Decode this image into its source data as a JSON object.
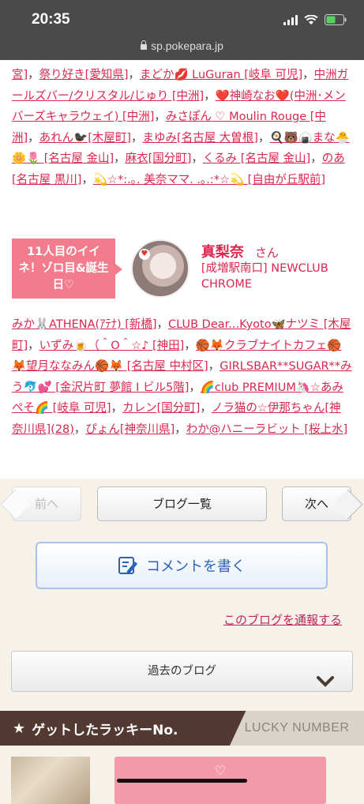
{
  "status_bar": {
    "time": "20:35",
    "url": "sp.pokepara.jp"
  },
  "likes_top": [
    {
      "text": "宮]"
    },
    {
      "text": "祭り好き[愛知県]"
    },
    {
      "text": "まどか💋 LuGuran [岐阜 可児]"
    },
    {
      "text": "中洲ガールズバー/クリスタル/じゅり [中洲]"
    },
    {
      "text": "❤️神崎なお❤️(中洲･メンバーズキャラウェイ) [中洲]"
    },
    {
      "text": "みさぽん ♡ Moulin Rouge [中洲]"
    },
    {
      "text": "あれん🐦‍⬛[木屋町]"
    },
    {
      "text": "まゆみ[名古屋 大曽根]"
    },
    {
      "text": "🍳🐻🍙まな🐣🌼🌷 [名古屋 金山]"
    },
    {
      "text": "麻衣[国分町]"
    },
    {
      "text": "くるみ [名古屋 金山]"
    },
    {
      "text": "のあ[名古屋 黒川]"
    },
    {
      "text": "💫☆*:.｡. 美奈ママ. .｡.:*☆💫 [自由が丘駅前]"
    }
  ],
  "feature": {
    "badge": "11人目のイイネ！ゾロ目&誕生日♡",
    "name": "真梨奈",
    "honorific": "さん",
    "shop": "[成増駅南口] NEWCLUB CHROME"
  },
  "likes_bottom": [
    {
      "text": "みか🐰ATHENA(ｱﾃﾅ) [新橋]"
    },
    {
      "text": "CLUB Dear...Kyoto🦋ナツミ [木屋町]"
    },
    {
      "text": "いずみ🍺（＾O＾☆♪ [神田]"
    },
    {
      "text": "🏀🦊クラブナイトカフェ🏀🦊望月ななみん🏀🦊 [名古屋 中村区]"
    },
    {
      "text": "GIRLSBAR**SUGAR**みう🐬💕 [金沢片町 夢館 I ビル5階]"
    },
    {
      "text": "🌈club PREMIUM🦄☆あみぺそ🌈 [岐阜 可児]"
    },
    {
      "text": "カレン[国分町]"
    },
    {
      "text": "ノラ猫の☆伊那ちゃん[神奈川県](28)"
    },
    {
      "text": "ぴょん[神奈川県]"
    },
    {
      "text": "わか@ハニーラビット [桜上水]"
    }
  ],
  "separator": "，",
  "nav": {
    "prev": "前へ",
    "list": "ブログ一覧",
    "next": "次へ"
  },
  "comment_button": "コメントを書く",
  "report_link": "このブログを通報する",
  "past_blog": "過去のブログ",
  "lucky": {
    "title": "ゲットしたラッキーNo.",
    "subtitle": "LUCKY NUMBER",
    "heart": "♡"
  },
  "colors": {
    "link": "#d9284f",
    "badge": "#f27c8c",
    "lucky_header": "#523a32",
    "comment_text": "#2c63b9"
  }
}
